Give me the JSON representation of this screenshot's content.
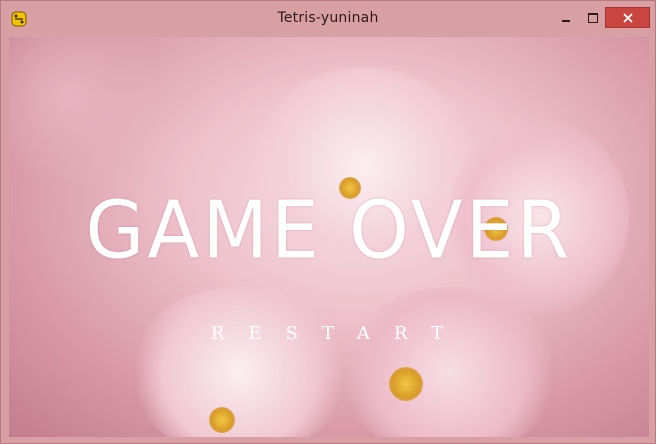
{
  "window": {
    "title": "Tetris-yuninah",
    "icon": "python-icon"
  },
  "colors": {
    "titlebar": "#d9a0a4",
    "close_button": "#c8463f",
    "text": "#ffffff"
  },
  "game": {
    "heading": "GAME OVER",
    "restart_label": "RESTART",
    "background": "pink cherry blossom photo"
  }
}
